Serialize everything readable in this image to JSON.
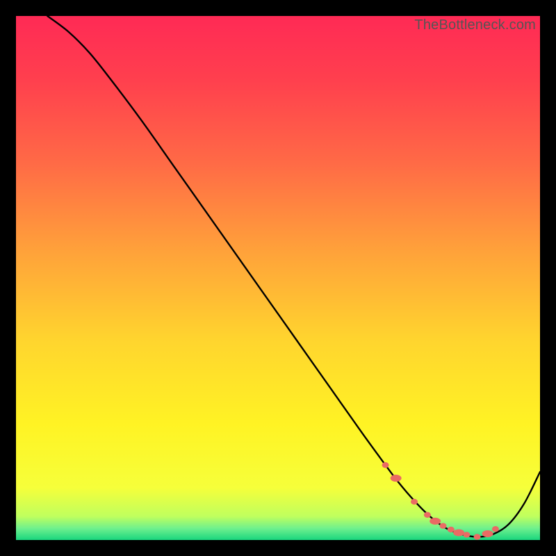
{
  "watermark": "TheBottleneck.com",
  "colors": {
    "background": "#000000",
    "curve_stroke": "#000000",
    "marker_fill": "#ea6a64",
    "gradient_stops": [
      {
        "offset": 0.0,
        "color": "#ff2a55"
      },
      {
        "offset": 0.12,
        "color": "#ff3f4e"
      },
      {
        "offset": 0.28,
        "color": "#ff6a46"
      },
      {
        "offset": 0.45,
        "color": "#ffa23a"
      },
      {
        "offset": 0.62,
        "color": "#ffd52e"
      },
      {
        "offset": 0.78,
        "color": "#fff324"
      },
      {
        "offset": 0.9,
        "color": "#f6ff3a"
      },
      {
        "offset": 0.955,
        "color": "#bfff5e"
      },
      {
        "offset": 0.978,
        "color": "#6ef08e"
      },
      {
        "offset": 1.0,
        "color": "#19d67e"
      }
    ]
  },
  "chart_data": {
    "type": "line",
    "title": "",
    "xlabel": "",
    "ylabel": "",
    "xlim": [
      0,
      100
    ],
    "ylim": [
      0,
      100
    ],
    "series": [
      {
        "name": "bottleneck-curve",
        "x": [
          6,
          10,
          14,
          18,
          24,
          30,
          36,
          42,
          48,
          54,
          60,
          66,
          70,
          73,
          76,
          79,
          82,
          85,
          88,
          91,
          94,
          97,
          100
        ],
        "y": [
          100,
          97,
          93,
          88,
          80,
          71.5,
          63,
          54.5,
          46,
          37.5,
          29,
          20.5,
          15,
          11,
          7.5,
          4.5,
          2.3,
          1.1,
          0.6,
          1.1,
          3.0,
          7.0,
          13
        ]
      }
    ],
    "markers": {
      "name": "optimal-range-markers",
      "x": [
        70.5,
        72.5,
        76.0,
        78.5,
        80.0,
        81.5,
        83.0,
        84.5,
        86.0,
        88.0,
        90.0,
        91.5
      ],
      "y": [
        14.3,
        11.8,
        7.3,
        4.8,
        3.6,
        2.7,
        2.0,
        1.4,
        1.0,
        0.6,
        1.2,
        2.1
      ]
    }
  }
}
